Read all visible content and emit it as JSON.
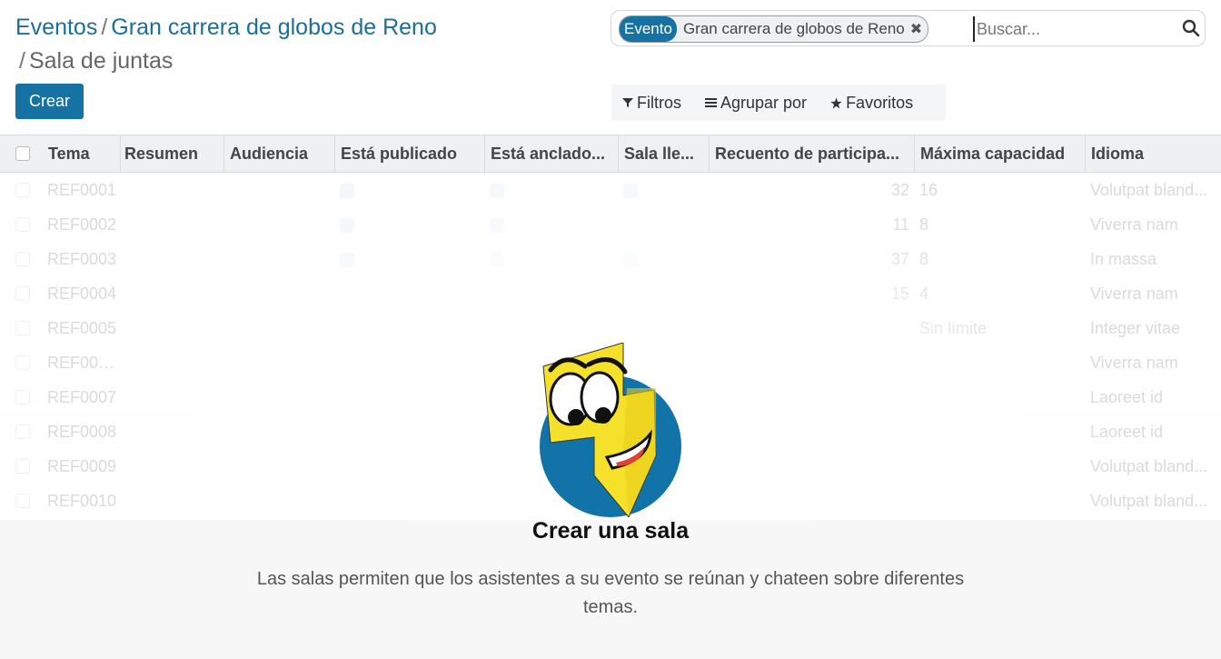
{
  "breadcrumb": {
    "root": "Eventos",
    "event": "Gran carrera de globos de Reno",
    "current": "Sala de juntas",
    "separator": "/"
  },
  "buttons": {
    "create": "Crear"
  },
  "search": {
    "facet_category": "Evento",
    "facet_value": "Gran carrera de globos de Reno",
    "facet_close": "✖",
    "placeholder": "Buscar..."
  },
  "filters": {
    "filters_label": "Filtros",
    "groupby_label": "Agrupar por",
    "favorites_label": "Favoritos"
  },
  "table": {
    "columns": [
      "Tema",
      "Resumen",
      "Audiencia",
      "Está publicado",
      "Está anclado...",
      "Sala lle...",
      "Recuento de participa...",
      "Máxima capacidad",
      "Idioma"
    ],
    "rows": [
      {
        "ref": "REF0001",
        "pub": true,
        "pin": true,
        "full": true,
        "count": "32",
        "cap": "16",
        "lang": "Volutpat bland..."
      },
      {
        "ref": "REF0002",
        "pub": true,
        "pin": true,
        "full": false,
        "count": "11",
        "cap": "8",
        "lang": "Viverra nam"
      },
      {
        "ref": "REF0003",
        "pub": true,
        "pin": true,
        "full": true,
        "count": "37",
        "cap": "8",
        "lang": "In massa"
      },
      {
        "ref": "REF0004",
        "pub": false,
        "pin": false,
        "full": false,
        "count": "15",
        "cap": "4",
        "lang": "Viverra nam"
      },
      {
        "ref": "REF0005",
        "pub": false,
        "pin": false,
        "full": false,
        "count": "",
        "cap": "Sin límite",
        "lang": "Integer vitae"
      },
      {
        "ref": "REF000...",
        "pub": false,
        "pin": false,
        "full": false,
        "count": "",
        "cap": "",
        "lang": "Viverra nam"
      },
      {
        "ref": "REF0007",
        "pub": false,
        "pin": false,
        "full": false,
        "count": "",
        "cap": "",
        "lang": "Laoreet id"
      },
      {
        "ref": "REF0008",
        "pub": false,
        "pin": false,
        "full": false,
        "count": "",
        "cap": "",
        "lang": "Laoreet id"
      },
      {
        "ref": "REF0009",
        "pub": false,
        "pin": false,
        "full": false,
        "count": "",
        "cap": "",
        "lang": "Volutpat bland..."
      },
      {
        "ref": "REF0010",
        "pub": false,
        "pin": false,
        "full": false,
        "count": "",
        "cap": "",
        "lang": "Volutpat bland..."
      }
    ]
  },
  "helper": {
    "title": "Crear una sala",
    "description": "Las salas permiten que los asistentes a su evento se reúnan y chateen sobre diferentes temas."
  },
  "colors": {
    "brand": "#1572a3",
    "mascot_yellow": "#f6e12a",
    "mascot_blue": "#1173a8"
  }
}
